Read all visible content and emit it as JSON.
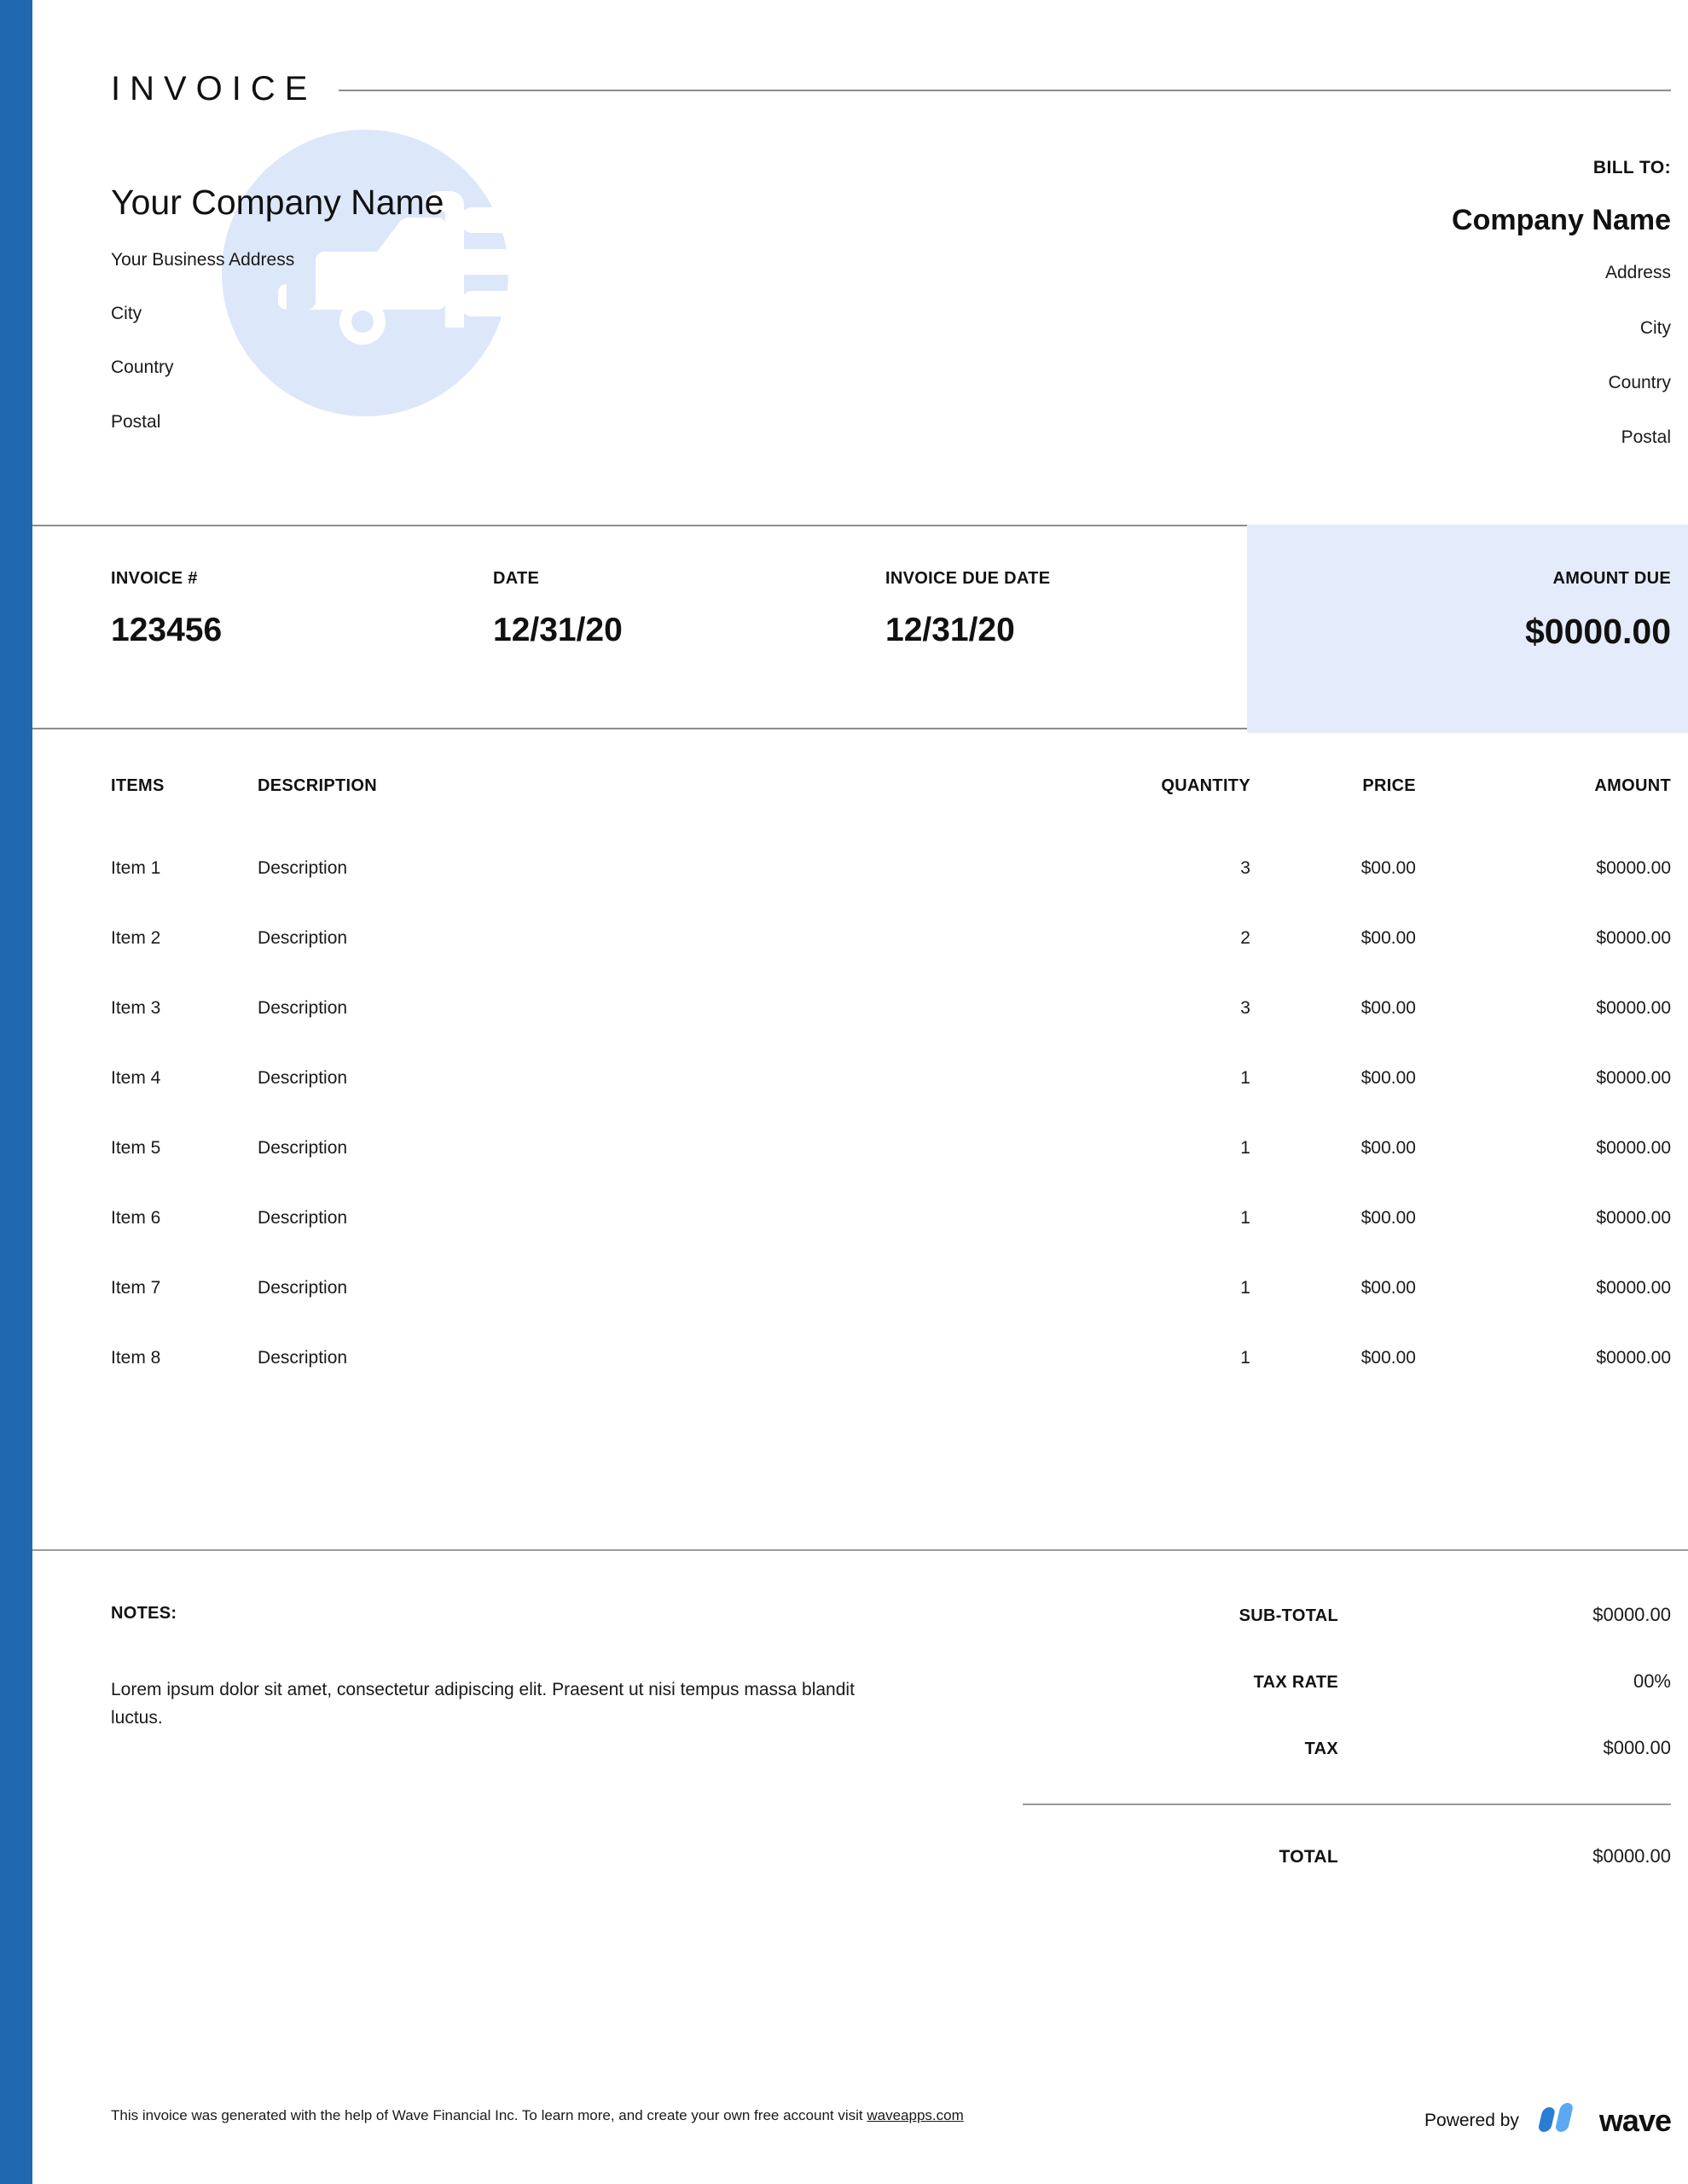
{
  "document": {
    "title": "INVOICE"
  },
  "sender": {
    "company_name": "Your Company Name",
    "address": "Your Business Address",
    "city": "City",
    "country": "Country",
    "postal": "Postal"
  },
  "bill_to": {
    "label": "BILL TO:",
    "company_name": "Company Name",
    "address": "Address",
    "city": "City",
    "country": "Country",
    "postal": "Postal"
  },
  "meta": {
    "invoice_number_label": "INVOICE #",
    "invoice_number": "123456",
    "date_label": "DATE",
    "date": "12/31/20",
    "due_date_label": "INVOICE DUE DATE",
    "due_date": "12/31/20",
    "amount_due_label": "AMOUNT DUE",
    "amount_due": "$0000.00"
  },
  "items_table": {
    "headers": {
      "item": "ITEMS",
      "description": "DESCRIPTION",
      "quantity": "QUANTITY",
      "price": "PRICE",
      "amount": "AMOUNT"
    },
    "rows": [
      {
        "item": "Item 1",
        "description": "Description",
        "quantity": "3",
        "price": "$00.00",
        "amount": "$0000.00"
      },
      {
        "item": "Item 2",
        "description": "Description",
        "quantity": "2",
        "price": "$00.00",
        "amount": "$0000.00"
      },
      {
        "item": "Item 3",
        "description": "Description",
        "quantity": "3",
        "price": "$00.00",
        "amount": "$0000.00"
      },
      {
        "item": "Item 4",
        "description": "Description",
        "quantity": "1",
        "price": "$00.00",
        "amount": "$0000.00"
      },
      {
        "item": "Item 5",
        "description": "Description",
        "quantity": "1",
        "price": "$00.00",
        "amount": "$0000.00"
      },
      {
        "item": "Item 6",
        "description": "Description",
        "quantity": "1",
        "price": "$00.00",
        "amount": "$0000.00"
      },
      {
        "item": "Item 7",
        "description": "Description",
        "quantity": "1",
        "price": "$00.00",
        "amount": "$0000.00"
      },
      {
        "item": "Item 8",
        "description": "Description",
        "quantity": "1",
        "price": "$00.00",
        "amount": "$0000.00"
      }
    ]
  },
  "notes": {
    "label": "NOTES:",
    "text": "Lorem ipsum dolor sit amet, consectetur adipiscing elit. Praesent ut nisi tempus massa blandit luctus."
  },
  "totals": {
    "subtotal_label": "SUB-TOTAL",
    "subtotal_value": "$0000.00",
    "tax_rate_label": "TAX RATE",
    "tax_rate_value": "00%",
    "tax_label": "TAX",
    "tax_value": "$000.00",
    "total_label": "TOTAL",
    "total_value": "$0000.00"
  },
  "footer": {
    "note_prefix": "This invoice was generated with the help of Wave Financial Inc. To learn more, and create your own free account visit ",
    "link_text": "waveapps.com",
    "powered_by": "Powered by",
    "brand": "wave"
  },
  "colors": {
    "accent_bar": "#2068b0",
    "amount_due_bg": "#e4ebfa",
    "watermark": "#dde7fa",
    "rule": "#8d8d8d",
    "wave_blue_dark": "#2b7cd3",
    "wave_blue_light": "#5ba9f0"
  },
  "icons": {
    "watermark": "delivery-truck-icon",
    "brand_mark": "wave-logo-icon"
  }
}
